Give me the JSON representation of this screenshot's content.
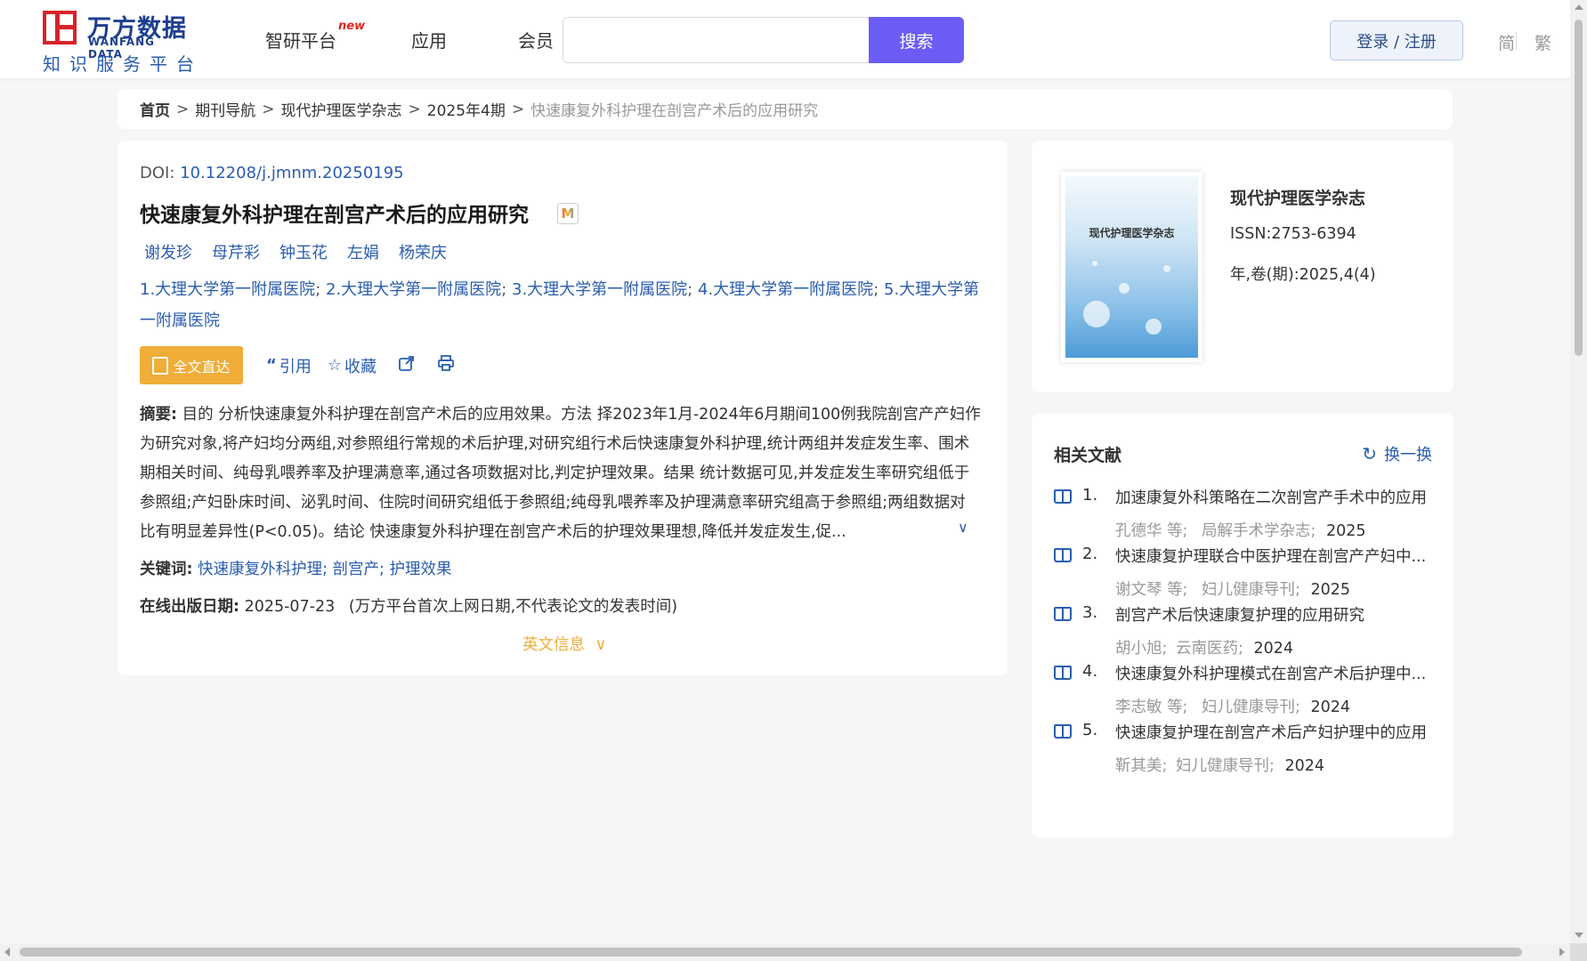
{
  "header": {
    "logo_cn": "万方数据",
    "logo_en": "WANFANG DATA",
    "logo_sub": "知识服务平台",
    "nav": [
      {
        "label": "智研平台"
      },
      {
        "label": "应用"
      },
      {
        "label": "会员"
      }
    ],
    "nav_new_badge": "new",
    "search_placeholder": "",
    "search_button": "搜索",
    "login_button": "登录 / 注册",
    "lang_simplified": "简",
    "lang_traditional": "繁"
  },
  "breadcrumb": {
    "items": [
      "首页",
      "期刊导航",
      "现代护理医学杂志",
      "2025年4期"
    ],
    "current": "快速康复外科护理在剖宫产术后的应用研究",
    "separator": ">"
  },
  "article": {
    "doi_label": "DOI:",
    "doi_value": "10.12208/j.jmnm.20250195",
    "title": "快速康复外科护理在剖宫产术后的应用研究",
    "badge": "M",
    "authors": [
      "谢发珍",
      "母芹彩",
      "钟玉花",
      "左娟",
      "杨荣庆"
    ],
    "affiliations": [
      "1.大理大学第一附属医院",
      "2.大理大学第一附属医院",
      "3.大理大学第一附属医院",
      "4.大理大学第一附属医院",
      "5.大理大学第一附属医院"
    ],
    "affil_sep": ";",
    "fulltext_button": "全文直达",
    "cite_label": "引用",
    "collect_label": "收藏",
    "abstract_label": "摘要:",
    "abstract_text": "目的 分析快速康复外科护理在剖宫产术后的应用效果。方法 择2023年1月-2024年6月期间100例我院剖宫产产妇作为研究对象,将产妇均分两组,对参照组行常规的术后护理,对研究组行术后快速康复外科护理,统计两组并发症发生率、围术期相关时间、纯母乳喂养率及护理满意率,通过各项数据对比,判定护理效果。结果 统计数据可见,并发症发生率研究组低于参照组;产妇卧床时间、泌乳时间、住院时间研究组低于参照组;纯母乳喂养率及护理满意率研究组高于参照组;两组数据对比有明显差异性(P<0.05)。结论 快速康复外科护理在剖宫产术后的护理效果理想,降低并发症发生,促...",
    "keywords_label": "关键词:",
    "keywords": [
      "快速康复外科护理",
      "剖宫产",
      "护理效果"
    ],
    "pubdate_label": "在线出版日期:",
    "pubdate_value": "2025-07-23",
    "pubdate_note": "(万方平台首次上网日期,不代表论文的发表时间)",
    "en_info": "英文信息"
  },
  "journal": {
    "cover_title": "现代护理医学杂志",
    "name": "现代护理医学杂志",
    "issn": "ISSN:2753-6394",
    "volume": "年,卷(期):2025,4(4)"
  },
  "related": {
    "title": "相关文献",
    "refresh": "换一换",
    "items": [
      {
        "num": "1.",
        "title": "加速康复外科策略在二次剖宫产手术中的应用",
        "authors": "孔德华 等;",
        "journal": "局解手术学杂志;",
        "year": "2025"
      },
      {
        "num": "2.",
        "title": "快速康复护理联合中医护理在剖宫产产妇中...",
        "authors": "谢文琴 等;",
        "journal": "妇儿健康导刊;",
        "year": "2025"
      },
      {
        "num": "3.",
        "title": "剖宫产术后快速康复护理的应用研究",
        "authors": "胡小旭;",
        "journal": "云南医药;",
        "year": "2024"
      },
      {
        "num": "4.",
        "title": "快速康复外科护理模式在剖宫产术后护理中...",
        "authors": "李志敏 等;",
        "journal": "妇儿健康导刊;",
        "year": "2024"
      },
      {
        "num": "5.",
        "title": "快速康复护理在剖宫产术后产妇护理中的应用",
        "authors": "靳其美;",
        "journal": "妇儿健康导刊;",
        "year": "2024"
      }
    ]
  },
  "colors": {
    "primary": "#6b5cf6",
    "link": "#2a5db0",
    "accent": "#f0ad38",
    "logo_red": "#d8232a"
  }
}
